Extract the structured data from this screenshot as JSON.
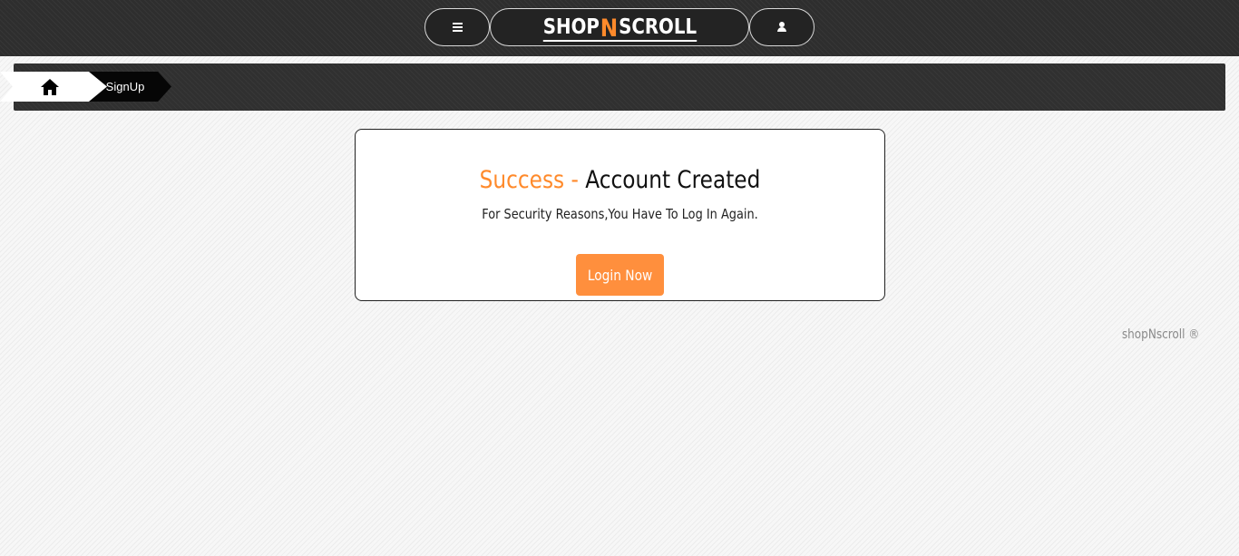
{
  "topbar": {
    "menu_icon": "hamburger-menu-icon",
    "logo": {
      "part1": "SHOP",
      "part2": "N",
      "part3": "SCROLL"
    },
    "user_icon": "user-icon"
  },
  "breadcrumb": {
    "home_icon": "home-icon",
    "current": "SignUp"
  },
  "card": {
    "title_success": "Success -",
    "title_rest": "Account Created",
    "message": "For Security Reasons,You Have To Log In Again.",
    "button_label": "Login Now"
  },
  "footer": {
    "text": "shopNscroll ®"
  },
  "colors": {
    "accent": "#ff8a2b",
    "topbar": "#2e2e2e",
    "crumb_active": "#060606"
  }
}
